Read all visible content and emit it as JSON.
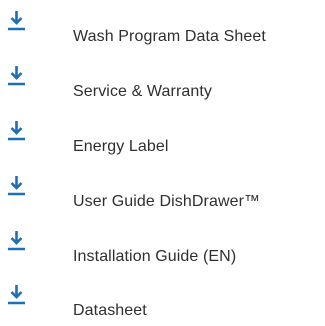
{
  "colors": {
    "icon": "#1f6fb7",
    "text": "#2f2f2f",
    "background": "#ffffff"
  },
  "downloads": {
    "icon_name": "download-icon",
    "items": [
      {
        "label": "Wash Program Data Sheet"
      },
      {
        "label": "Service & Warranty"
      },
      {
        "label": "Energy Label"
      },
      {
        "label": "User Guide DishDrawer™"
      },
      {
        "label": "Installation Guide (EN)"
      },
      {
        "label": "Datasheet"
      }
    ]
  }
}
